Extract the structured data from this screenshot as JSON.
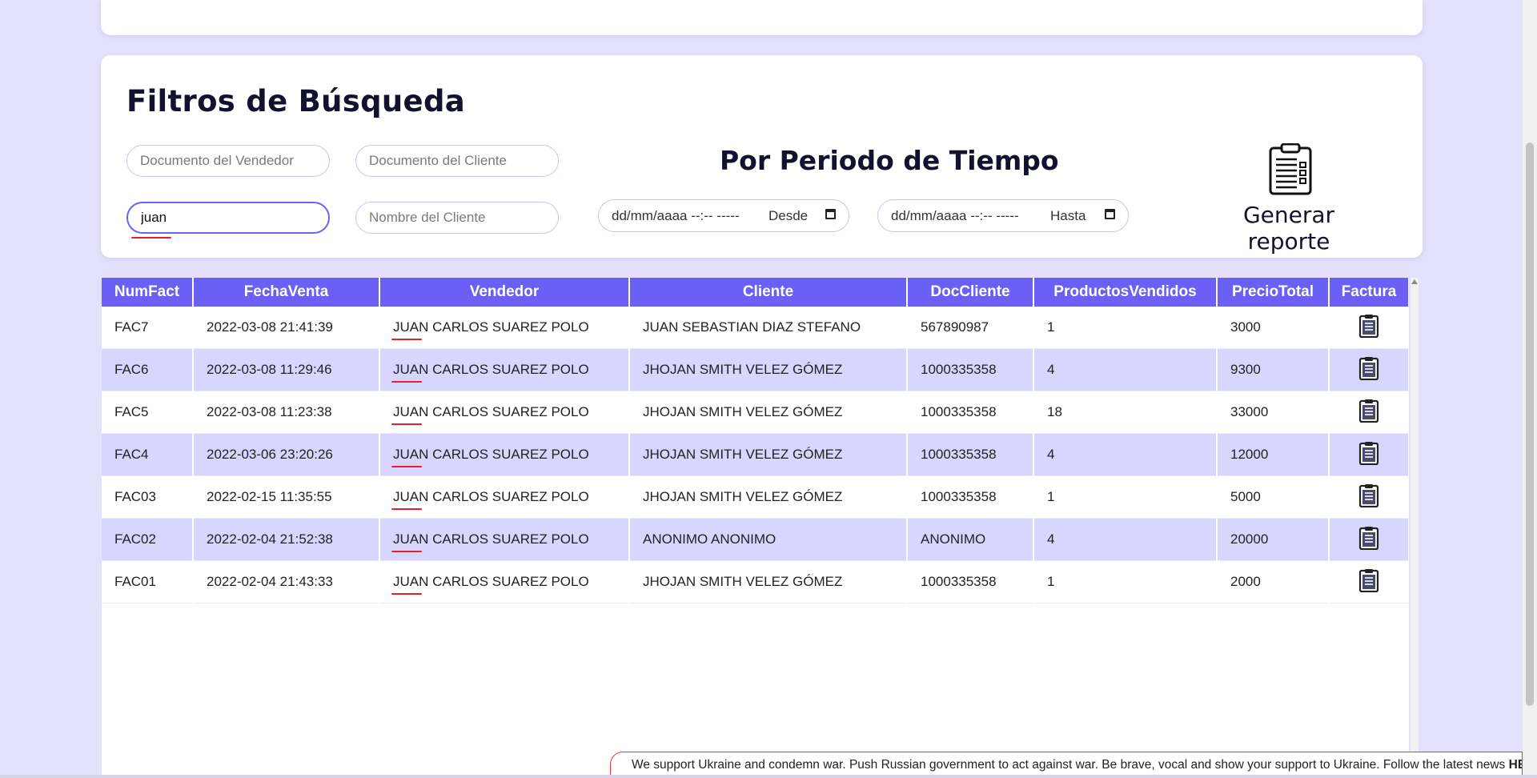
{
  "filters": {
    "title": "Filtros de Búsqueda",
    "seller_doc_placeholder": "Documento del Vendedor",
    "client_doc_placeholder": "Documento del Cliente",
    "seller_name_value": "juan",
    "client_name_placeholder": "Nombre del Cliente",
    "period_title": "Por Periodo de Tiempo",
    "date_mask": "dd/mm/aaaa --:-- -----",
    "from_label": "Desde",
    "to_label": "Hasta",
    "report_label": "Generar reporte"
  },
  "table": {
    "headers": [
      "NumFact",
      "FechaVenta",
      "Vendedor",
      "Cliente",
      "DocCliente",
      "ProductosVendidos",
      "PrecioTotal",
      "Factura"
    ],
    "rows": [
      {
        "num": "FAC7",
        "fecha": "2022-03-08 21:41:39",
        "vendedor_hl": "JUAN",
        "vendedor_rest": " CARLOS SUAREZ POLO",
        "cliente": "JUAN SEBASTIAN DIAZ STEFANO",
        "doc": "567890987",
        "productos": "1",
        "precio": "3000"
      },
      {
        "num": "FAC6",
        "fecha": "2022-03-08 11:29:46",
        "vendedor_hl": "JUAN",
        "vendedor_rest": " CARLOS SUAREZ POLO",
        "cliente": "JHOJAN SMITH VELEZ GÓMEZ",
        "doc": "1000335358",
        "productos": "4",
        "precio": "9300"
      },
      {
        "num": "FAC5",
        "fecha": "2022-03-08 11:23:38",
        "vendedor_hl": "JUAN",
        "vendedor_rest": " CARLOS SUAREZ POLO",
        "cliente": "JHOJAN SMITH VELEZ GÓMEZ",
        "doc": "1000335358",
        "productos": "18",
        "precio": "33000"
      },
      {
        "num": "FAC4",
        "fecha": "2022-03-06 23:20:26",
        "vendedor_hl": "JUAN",
        "vendedor_rest": " CARLOS SUAREZ POLO",
        "cliente": "JHOJAN SMITH VELEZ GÓMEZ",
        "doc": "1000335358",
        "productos": "4",
        "precio": "12000"
      },
      {
        "num": "FAC03",
        "fecha": "2022-02-15 11:35:55",
        "vendedor_hl": "JUAN",
        "vendedor_rest": " CARLOS SUAREZ POLO",
        "cliente": "JHOJAN SMITH VELEZ GÓMEZ",
        "doc": "1000335358",
        "productos": "1",
        "precio": "5000"
      },
      {
        "num": "FAC02",
        "fecha": "2022-02-04 21:52:38",
        "vendedor_hl": "JUAN",
        "vendedor_rest": " CARLOS SUAREZ POLO",
        "cliente": "ANONIMO ANONIMO",
        "doc": "ANONIMO",
        "productos": "4",
        "precio": "20000"
      },
      {
        "num": "FAC01",
        "fecha": "2022-02-04 21:43:33",
        "vendedor_hl": "JUAN",
        "vendedor_rest": " CARLOS SUAREZ POLO",
        "cliente": "JHOJAN SMITH VELEZ GÓMEZ",
        "doc": "1000335358",
        "productos": "1",
        "precio": "2000"
      }
    ],
    "invoice_icon": "clipboard-icon"
  },
  "notice": {
    "text": "We support Ukraine and condemn war. Push Russian government to act against war. Be brave, vocal and show your support to Ukraine. Follow the latest news ",
    "link": "HERE"
  },
  "colors": {
    "background": "#e3e0fb",
    "header": "#6a60f6",
    "row_alt": "#d8d6fe",
    "notice_border": "#e23b3b"
  }
}
